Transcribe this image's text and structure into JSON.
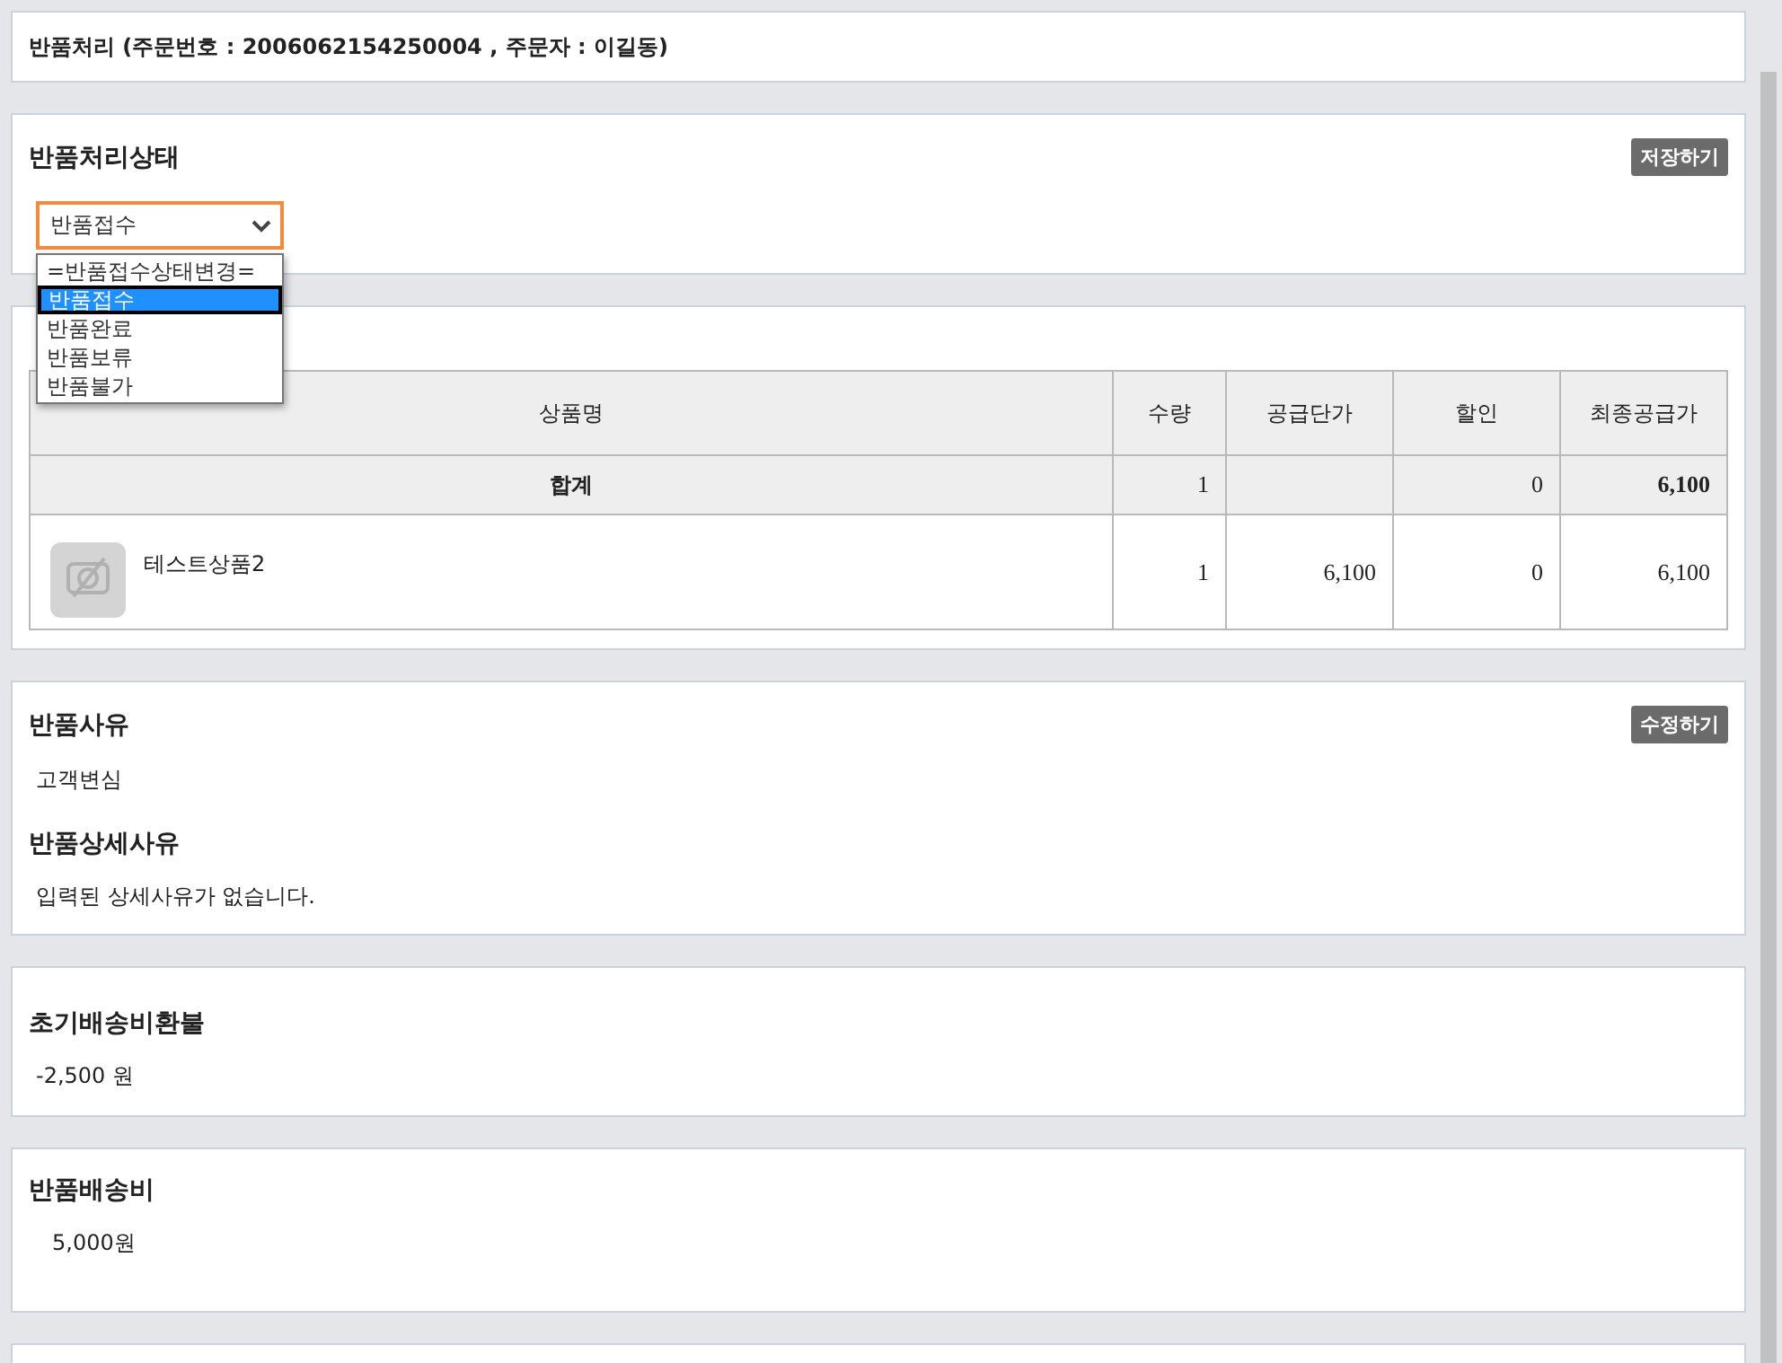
{
  "header": {
    "title": "반품처리 (주문번호 : 2006062154250004 , 주문자 : 이길동)"
  },
  "status_card": {
    "title": "반품처리상태",
    "save_button": "저장하기",
    "select": {
      "value": "반품접수",
      "open": true,
      "options": [
        {
          "label": "=반품접수상태변경=",
          "selected": false
        },
        {
          "label": "반품접수",
          "selected": true
        },
        {
          "label": "반품완료",
          "selected": false
        },
        {
          "label": "반품보류",
          "selected": false
        },
        {
          "label": "반품불가",
          "selected": false
        }
      ]
    }
  },
  "items_card": {
    "table": {
      "columns": [
        "상품명",
        "수량",
        "공급단가",
        "할인",
        "최종공급가"
      ],
      "total": {
        "label": "합계",
        "qty": "1",
        "discount": "0",
        "final": "6,100"
      },
      "rows": [
        {
          "name": "테스트상품2",
          "qty": "1",
          "unit_price": "6,100",
          "discount": "0",
          "final": "6,100"
        }
      ]
    }
  },
  "reason_card": {
    "title": "반품사유",
    "edit_button": "수정하기",
    "text": "고객변심",
    "detail_title": "반품상세사유",
    "detail_text": "입력된 상세사유가 없습니다."
  },
  "refund_card": {
    "title": "초기배송비환불",
    "value": "-2,500 원"
  },
  "shipping_card": {
    "title": "반품배송비",
    "value": "5,000원"
  }
}
